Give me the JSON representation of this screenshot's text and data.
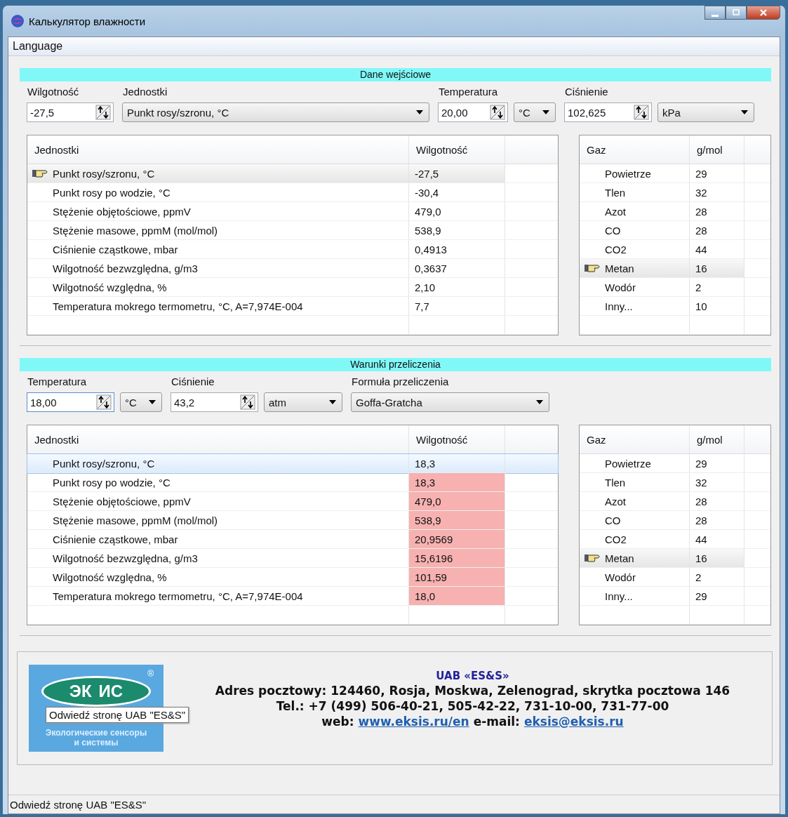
{
  "window": {
    "title": "Калькулятор влажности"
  },
  "menu": [
    "Language"
  ],
  "input_section": {
    "title": "Dane wejściowe",
    "humidity": {
      "label": "Wilgotność",
      "value": "-27,5"
    },
    "units": {
      "label": "Jednostki",
      "value": "Punkt rosy/szronu, °C"
    },
    "temperature": {
      "label": "Temperatura",
      "value": "20,00",
      "unit": "°C"
    },
    "pressure": {
      "label": "Ciśnienie",
      "value": "102,625",
      "unit": "kPa"
    },
    "table": {
      "columns": [
        "Jednostki",
        "Wilgotność"
      ],
      "rows": [
        {
          "unit": "Punkt rosy/szronu, °C",
          "value": "-27,5",
          "selected": true,
          "out_of_range": false
        },
        {
          "unit": "Punkt rosy po wodzie, °C",
          "value": "-30,4",
          "selected": false,
          "out_of_range": false
        },
        {
          "unit": "Stężenie objętościowe, ppmV",
          "value": "479,0",
          "selected": false,
          "out_of_range": false
        },
        {
          "unit": "Stężenie masowe, ppmM (mol/mol)",
          "value": "538,9",
          "selected": false,
          "out_of_range": false
        },
        {
          "unit": "Ciśnienie cząstkowe, mbar",
          "value": "0,4913",
          "selected": false,
          "out_of_range": false
        },
        {
          "unit": "Wilgotność bezwzględna, g/m3",
          "value": "0,3637",
          "selected": false,
          "out_of_range": false
        },
        {
          "unit": "Wilgotność względna, %",
          "value": "2,10",
          "selected": false,
          "out_of_range": false
        },
        {
          "unit": "Temperatura mokrego termometru, °C, A=7,974E-004",
          "value": "7,7",
          "selected": false,
          "out_of_range": false
        }
      ]
    },
    "gases": {
      "columns": [
        "Gaz",
        "g/mol"
      ],
      "rows": [
        {
          "name": "Powietrze",
          "value": "29",
          "selected": false
        },
        {
          "name": "Tlen",
          "value": "32",
          "selected": false
        },
        {
          "name": "Azot",
          "value": "28",
          "selected": false
        },
        {
          "name": "CO",
          "value": "28",
          "selected": false
        },
        {
          "name": "CO2",
          "value": "44",
          "selected": false
        },
        {
          "name": "Metan",
          "value": "16",
          "selected": true
        },
        {
          "name": "Wodór",
          "value": "2",
          "selected": false
        },
        {
          "name": "Inny...",
          "value": "10",
          "selected": false
        }
      ]
    }
  },
  "conversion_section": {
    "title": "Warunki przeliczenia",
    "temperature": {
      "label": "Temperatura",
      "value": "18,00",
      "unit": "°C"
    },
    "pressure": {
      "label": "Ciśnienie",
      "value": "43,2",
      "unit": "atm"
    },
    "formula": {
      "label": "Formuła przeliczenia",
      "value": "Goffa-Gratcha"
    },
    "table": {
      "columns": [
        "Jednostki",
        "Wilgotność"
      ],
      "rows": [
        {
          "unit": "Punkt rosy/szronu, °C",
          "value": "18,3",
          "selected": true,
          "out_of_range": false
        },
        {
          "unit": "Punkt rosy po wodzie, °C",
          "value": "18,3",
          "selected": false,
          "out_of_range": true
        },
        {
          "unit": "Stężenie objętościowe, ppmV",
          "value": "479,0",
          "selected": false,
          "out_of_range": true
        },
        {
          "unit": "Stężenie masowe, ppmM (mol/mol)",
          "value": "538,9",
          "selected": false,
          "out_of_range": true
        },
        {
          "unit": "Ciśnienie cząstkowe, mbar",
          "value": "20,9569",
          "selected": false,
          "out_of_range": true
        },
        {
          "unit": "Wilgotność bezwzględna, g/m3",
          "value": "15,6196",
          "selected": false,
          "out_of_range": true
        },
        {
          "unit": "Wilgotność względna, %",
          "value": "101,59",
          "selected": false,
          "out_of_range": true
        },
        {
          "unit": "Temperatura mokrego termometru, °C, A=7,974E-004",
          "value": "18,0",
          "selected": false,
          "out_of_range": true
        }
      ]
    },
    "gases": {
      "columns": [
        "Gaz",
        "g/mol"
      ],
      "rows": [
        {
          "name": "Powietrze",
          "value": "29",
          "selected": false
        },
        {
          "name": "Tlen",
          "value": "32",
          "selected": false
        },
        {
          "name": "Azot",
          "value": "28",
          "selected": false
        },
        {
          "name": "CO",
          "value": "28",
          "selected": false
        },
        {
          "name": "CO2",
          "value": "44",
          "selected": false
        },
        {
          "name": "Metan",
          "value": "16",
          "selected": true
        },
        {
          "name": "Wodór",
          "value": "2",
          "selected": false
        },
        {
          "name": "Inny...",
          "value": "29",
          "selected": false
        }
      ]
    }
  },
  "footer": {
    "logo": {
      "letters_left": "ЭК",
      "letters_right": "ИС",
      "mark": "®",
      "line_1": "Экологические сенсоры",
      "line_2": "и системы"
    },
    "company": "UAB «ES&S»",
    "address": "Adres pocztowy: 124460, Rosja, Moskwa, Zelenograd, skrytka pocztowa 146",
    "phone": "Tel.: +7 (499) 506-40-21, 505-42-22, 731-10-00, 731-77-00",
    "web_label": "web:",
    "web_link": "www.eksis.ru/en",
    "email_label": "e-mail:",
    "email_link": "eksis@eksis.ru",
    "tooltip": "Odwiedź stronę UAB \"ES&S\""
  },
  "status_bar": "Odwiedź stronę UAB \"ES&S\""
}
